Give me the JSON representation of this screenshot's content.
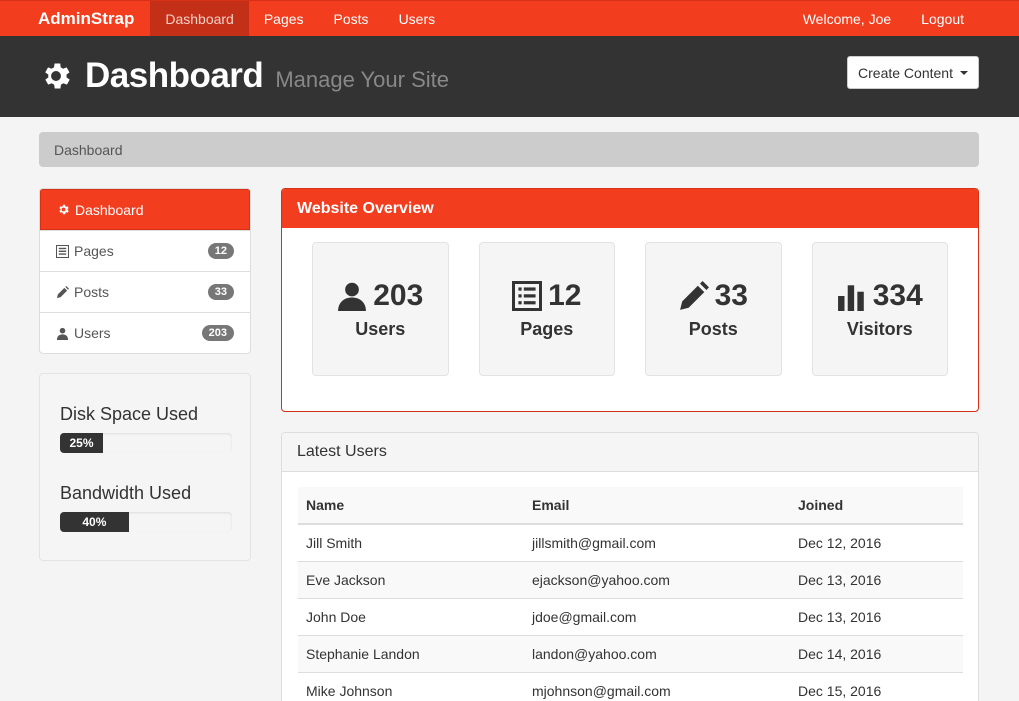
{
  "navbar": {
    "brand": "AdminStrap",
    "links": [
      "Dashboard",
      "Pages",
      "Posts",
      "Users"
    ],
    "welcome": "Welcome, Joe",
    "logout": "Logout",
    "accent_color": "#f23d1f"
  },
  "header": {
    "icon": "gear-icon",
    "title": "Dashboard",
    "subtitle": "Manage Your Site",
    "create_button": "Create Content"
  },
  "breadcrumb": "Dashboard",
  "sidebar": {
    "items": [
      {
        "label": "Dashboard",
        "icon": "gear-icon"
      },
      {
        "label": "Pages",
        "icon": "list-alt-icon",
        "count": "12"
      },
      {
        "label": "Posts",
        "icon": "pencil-icon",
        "count": "33"
      },
      {
        "label": "Users",
        "icon": "user-icon",
        "count": "203"
      }
    ]
  },
  "usage": {
    "disk_title": "Disk Space Used",
    "disk_value": "25%",
    "disk_fraction": 0.25,
    "bandwidth_title": "Bandwidth Used",
    "bandwidth_value": "40%",
    "bandwidth_fraction": 0.4
  },
  "overview": {
    "title": "Website Overview",
    "stats": [
      {
        "value": "203",
        "label": "Users",
        "icon": "user-icon"
      },
      {
        "value": "12",
        "label": "Pages",
        "icon": "list-alt-icon"
      },
      {
        "value": "33",
        "label": "Posts",
        "icon": "pencil-icon"
      },
      {
        "value": "334",
        "label": "Visitors",
        "icon": "bar-chart-icon"
      }
    ]
  },
  "latest_users": {
    "title": "Latest Users",
    "columns": [
      "Name",
      "Email",
      "Joined"
    ],
    "rows": [
      [
        "Jill Smith",
        "jillsmith@gmail.com",
        "Dec 12, 2016"
      ],
      [
        "Eve Jackson",
        "ejackson@yahoo.com",
        "Dec 13, 2016"
      ],
      [
        "John Doe",
        "jdoe@gmail.com",
        "Dec 13, 2016"
      ],
      [
        "Stephanie Landon",
        "landon@yahoo.com",
        "Dec 14, 2016"
      ],
      [
        "Mike Johnson",
        "mjohnson@gmail.com",
        "Dec 15, 2016"
      ]
    ]
  }
}
